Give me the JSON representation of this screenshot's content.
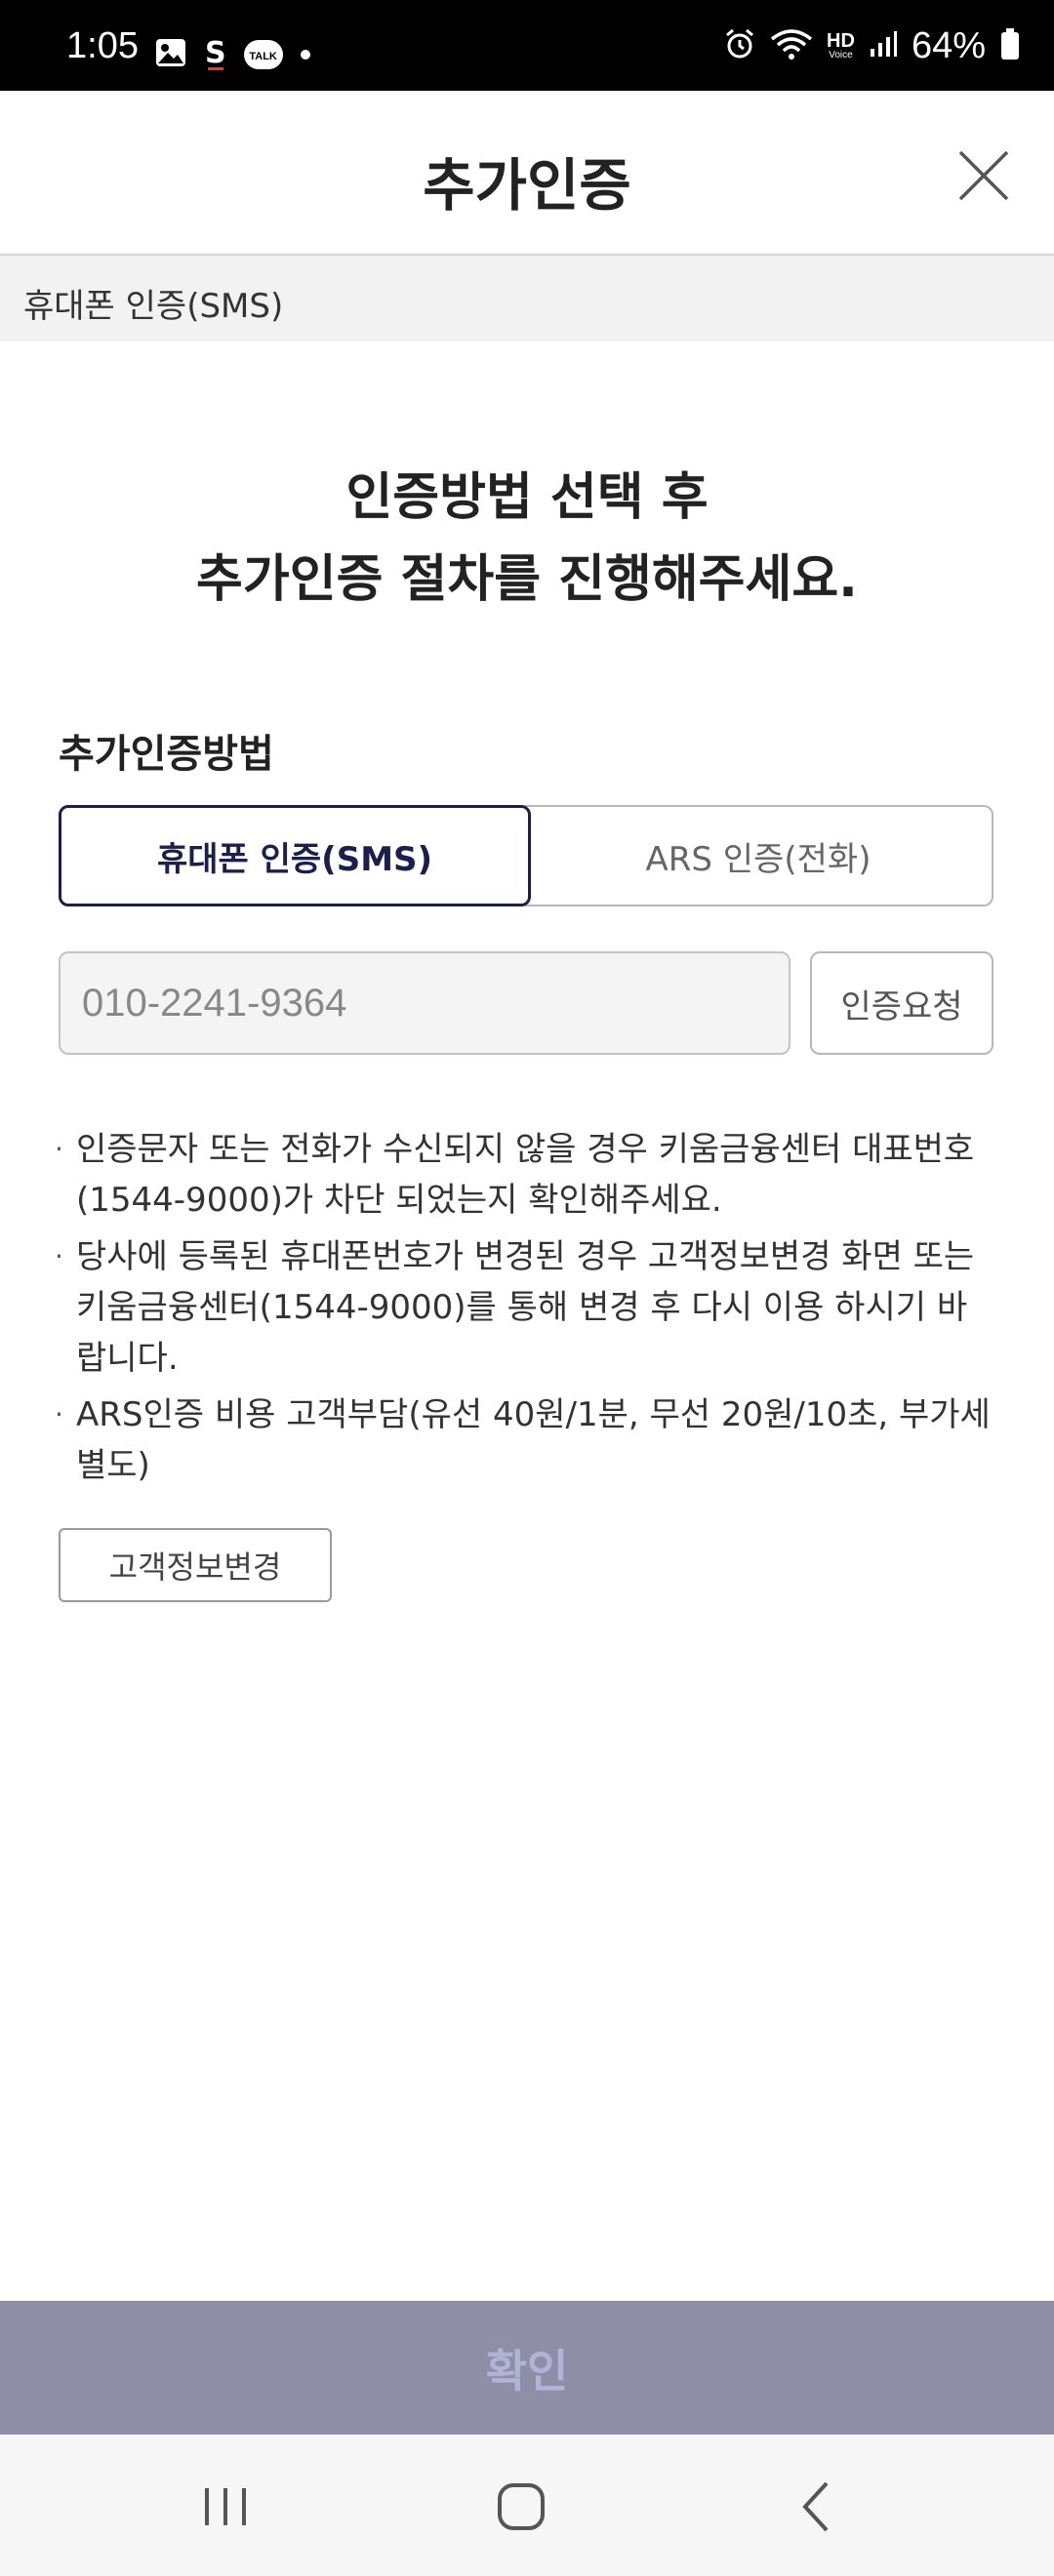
{
  "status_bar": {
    "time": "1:05",
    "battery": "64%",
    "icons_left": [
      "image-icon",
      "s-icon",
      "talk-icon",
      "dot-icon"
    ],
    "icons_right": [
      "alarm-icon",
      "wifi-icon",
      "hd-voice-icon",
      "signal-icon",
      "battery-icon"
    ],
    "talk_text": "TALK",
    "hd_text": "HD",
    "voice_text": "Voice",
    "s_text": "S"
  },
  "header": {
    "title": "추가인증",
    "close_icon": "close-icon"
  },
  "method_strip": {
    "label": "휴대폰 인증(SMS)"
  },
  "headline": {
    "line1": "인증방법 선택 후",
    "line2": "추가인증 절차를 진행해주세요."
  },
  "section": {
    "label": "추가인증방법"
  },
  "tabs": [
    {
      "label": "휴대폰 인증(SMS)",
      "active": true
    },
    {
      "label": "ARS 인증(전화)",
      "active": false
    }
  ],
  "phone": {
    "value": "010-2241-9364",
    "request_label": "인증요청"
  },
  "notes": [
    "인증문자 또는 전화가 수신되지 않을 경우 키움금융센터 대표번호(1544-9000)가 차단 되었는지 확인해주세요.",
    "당사에 등록된 휴대폰번호가 변경된 경우 고객정보변경 화면 또는 키움금융센터(1544-9000)를 통해 변경 후 다시 이용 하시기 바랍니다.",
    "ARS인증 비용 고객부담(유선 40원/1분, 무선 20원/10초, 부가세 별도)"
  ],
  "info_change_label": "고객정보변경",
  "confirm_label": "확인",
  "colors": {
    "primary": "#1a1f4d",
    "confirm_bg": "#8e8ea6",
    "confirm_text": "#b3b3d6"
  },
  "nav": {
    "items": [
      "recent-apps-icon",
      "home-icon",
      "back-icon"
    ]
  }
}
